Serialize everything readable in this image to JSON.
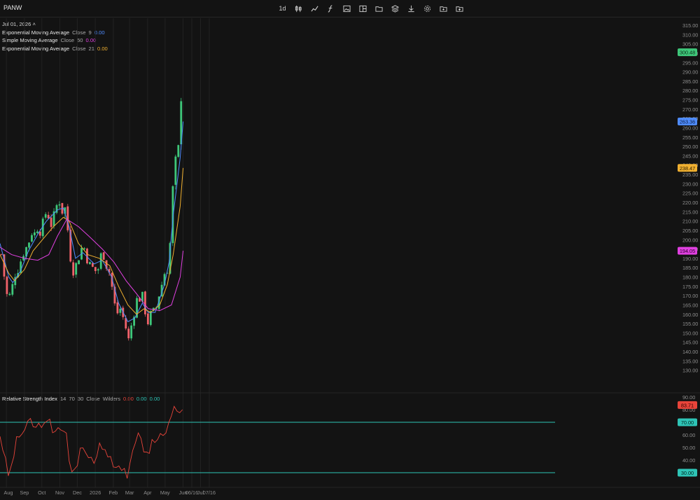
{
  "ticker": "PANW",
  "toolbar": {
    "interval_label": "1d",
    "icons": [
      "candles-icon",
      "line-chart-icon",
      "indicators-icon",
      "image-icon",
      "panel-icon",
      "folder-icon",
      "layers-icon",
      "download-icon",
      "settings-icon",
      "folder-add-icon",
      "file-upload-icon"
    ]
  },
  "legend": {
    "date": "Jul 01, 2026",
    "items": [
      {
        "name": "Exponential Moving Average",
        "source": "Close",
        "length": "9",
        "value": "0.00",
        "color": "#4f8cff"
      },
      {
        "name": "Simple Moving Average",
        "source": "Close",
        "length": "50",
        "value": "0.00",
        "color": "#e040e0"
      },
      {
        "name": "Exponential Moving Average",
        "source": "Close",
        "length": "21",
        "value": "0.00",
        "color": "#f0b030"
      }
    ]
  },
  "rsi_legend": {
    "name": "Relative Strength Index",
    "params": [
      "14",
      "70",
      "30",
      "Close",
      "Wilders"
    ],
    "values": [
      "0.00",
      "0.00",
      "0.00"
    ]
  },
  "colors": {
    "up": "#3ec77a",
    "down": "#f0626a",
    "ema9": "#4f8cff",
    "sma50": "#e040e0",
    "ema21": "#f0b030",
    "rsi": "#e8443a",
    "rsi_band": "#2ec4b6",
    "bg": "#131313",
    "grid": "#222222"
  },
  "price_labels": {
    "last": "300.48",
    "ema9": "263.36",
    "ema21": "238.47",
    "sma50": "194.05",
    "rsi": "83.71",
    "rsi_upper": "70.00",
    "rsi_lower": "30.00"
  },
  "x_axis_labels": [
    "Aug",
    "Sep",
    "Oct",
    "Nov",
    "Dec",
    "2026",
    "Feb",
    "Mar",
    "Apr",
    "May",
    "Jun",
    "06/16",
    "Jul",
    "07/16"
  ],
  "chart_data": [
    {
      "type": "candlestick",
      "title": "PANW",
      "ylim": [
        125,
        315
      ],
      "y_ticks": [
        130,
        135,
        140,
        145,
        150,
        155,
        160,
        165,
        170,
        175,
        180,
        185,
        190,
        195,
        200,
        205,
        210,
        215,
        220,
        225,
        230,
        235,
        240,
        245,
        250,
        255,
        260,
        265,
        270,
        275,
        280,
        285,
        290,
        295,
        300,
        305,
        310,
        315
      ],
      "close_path": [
        [
          "2025-07-21",
          201
        ],
        [
          "2025-07-24",
          190
        ],
        [
          "2025-07-28",
          181
        ],
        [
          "2025-07-31",
          172
        ],
        [
          "2025-08-05",
          168
        ],
        [
          "2025-08-08",
          172
        ],
        [
          "2025-08-12",
          176
        ],
        [
          "2025-08-15",
          181
        ],
        [
          "2025-08-20",
          183
        ],
        [
          "2025-08-25",
          188
        ],
        [
          "2025-08-29",
          192
        ],
        [
          "2025-09-03",
          195
        ],
        [
          "2025-09-08",
          198
        ],
        [
          "2025-09-12",
          203
        ],
        [
          "2025-09-16",
          205
        ],
        [
          "2025-09-19",
          203
        ],
        [
          "2025-09-24",
          207
        ],
        [
          "2025-09-29",
          204
        ],
        [
          "2025-10-02",
          208
        ],
        [
          "2025-10-06",
          212
        ],
        [
          "2025-10-09",
          216
        ],
        [
          "2025-10-13",
          212
        ],
        [
          "2025-10-16",
          207
        ],
        [
          "2025-10-21",
          212
        ],
        [
          "2025-10-24",
          215
        ],
        [
          "2025-10-28",
          220
        ],
        [
          "2025-10-31",
          221
        ],
        [
          "2025-11-04",
          216
        ],
        [
          "2025-11-07",
          214
        ],
        [
          "2025-11-11",
          218
        ],
        [
          "2025-11-13",
          210
        ],
        [
          "2025-11-17",
          198
        ],
        [
          "2025-11-20",
          188
        ],
        [
          "2025-11-24",
          183
        ],
        [
          "2025-11-28",
          186
        ],
        [
          "2025-12-03",
          190
        ],
        [
          "2025-12-08",
          195
        ],
        [
          "2025-12-11",
          198
        ],
        [
          "2025-12-16",
          192
        ],
        [
          "2025-12-19",
          188
        ],
        [
          "2025-12-24",
          186
        ],
        [
          "2025-12-30",
          184
        ],
        [
          "2026-01-05",
          182
        ],
        [
          "2026-01-08",
          190
        ],
        [
          "2026-01-13",
          193
        ],
        [
          "2026-01-16",
          191
        ],
        [
          "2026-01-21",
          185
        ],
        [
          "2026-01-26",
          182
        ],
        [
          "2026-01-29",
          176
        ],
        [
          "2026-02-02",
          168
        ],
        [
          "2026-02-05",
          162
        ],
        [
          "2026-02-10",
          160
        ],
        [
          "2026-02-13",
          163
        ],
        [
          "2026-02-18",
          158
        ],
        [
          "2026-02-23",
          152
        ],
        [
          "2026-02-26",
          145
        ],
        [
          "2026-03-02",
          150
        ],
        [
          "2026-03-05",
          156
        ],
        [
          "2026-03-10",
          162
        ],
        [
          "2026-03-13",
          168
        ],
        [
          "2026-03-18",
          168
        ],
        [
          "2026-03-23",
          170
        ],
        [
          "2026-03-26",
          164
        ],
        [
          "2026-03-30",
          158
        ],
        [
          "2026-04-02",
          155
        ],
        [
          "2026-04-06",
          160
        ],
        [
          "2026-04-09",
          163
        ],
        [
          "2026-04-14",
          160
        ],
        [
          "2026-04-17",
          166
        ],
        [
          "2026-04-22",
          172
        ],
        [
          "2026-04-27",
          178
        ],
        [
          "2026-04-30",
          182
        ],
        [
          "2026-05-05",
          184
        ],
        [
          "2026-05-08",
          190
        ],
        [
          "2026-05-12",
          210
        ],
        [
          "2026-05-15",
          232
        ],
        [
          "2026-05-19",
          242
        ],
        [
          "2026-05-22",
          245
        ],
        [
          "2026-05-27",
          255
        ],
        [
          "2026-05-29",
          282
        ],
        [
          "2026-06-01",
          300.48
        ]
      ],
      "series": [
        {
          "name": "Exponential Moving Average (Close, 9)",
          "values": [
            [
              "2025-07-21",
              198
            ],
            [
              "2025-08-05",
              180
            ],
            [
              "2025-08-12",
              177
            ],
            [
              "2025-08-25",
              183
            ],
            [
              "2025-09-08",
              194
            ],
            [
              "2025-09-24",
              203
            ],
            [
              "2025-10-09",
              210
            ],
            [
              "2025-10-28",
              216
            ],
            [
              "2025-11-07",
              217
            ],
            [
              "2025-11-17",
              207
            ],
            [
              "2025-11-28",
              190
            ],
            [
              "2025-12-11",
              193
            ],
            [
              "2025-12-30",
              187
            ],
            [
              "2026-01-13",
              189
            ],
            [
              "2026-01-29",
              180
            ],
            [
              "2026-02-10",
              166
            ],
            [
              "2026-02-26",
              156
            ],
            [
              "2026-03-10",
              158
            ],
            [
              "2026-03-23",
              166
            ],
            [
              "2026-04-02",
              161
            ],
            [
              "2026-04-14",
              161
            ],
            [
              "2026-04-30",
              176
            ],
            [
              "2026-05-08",
              188
            ],
            [
              "2026-05-15",
              213
            ],
            [
              "2026-05-27",
              244
            ],
            [
              "2026-06-01",
              263.36
            ]
          ]
        },
        {
          "name": "Exponential Moving Average (Close, 21)",
          "values": [
            [
              "2025-07-21",
              192
            ],
            [
              "2025-08-05",
              182
            ],
            [
              "2025-08-15",
              178
            ],
            [
              "2025-09-01",
              184
            ],
            [
              "2025-09-16",
              194
            ],
            [
              "2025-10-02",
              200
            ],
            [
              "2025-10-21",
              207
            ],
            [
              "2025-11-07",
              212
            ],
            [
              "2025-11-17",
              210
            ],
            [
              "2025-12-03",
              198
            ],
            [
              "2025-12-19",
              192
            ],
            [
              "2026-01-08",
              190
            ],
            [
              "2026-01-26",
              186
            ],
            [
              "2026-02-10",
              175
            ],
            [
              "2026-02-26",
              165
            ],
            [
              "2026-03-13",
              160
            ],
            [
              "2026-03-26",
              163
            ],
            [
              "2026-04-06",
              161
            ],
            [
              "2026-04-22",
              165
            ],
            [
              "2026-05-05",
              176
            ],
            [
              "2026-05-15",
              192
            ],
            [
              "2026-05-27",
              218
            ],
            [
              "2026-06-01",
              238.47
            ]
          ]
        },
        {
          "name": "Simple Moving Average (Close, 50)",
          "values": [
            [
              "2025-07-21",
              196
            ],
            [
              "2025-08-10",
              192
            ],
            [
              "2025-09-01",
              190
            ],
            [
              "2025-09-24",
              189
            ],
            [
              "2025-10-13",
              192
            ],
            [
              "2025-10-28",
              202
            ],
            [
              "2025-11-13",
              211
            ],
            [
              "2025-12-03",
              207
            ],
            [
              "2025-12-24",
              201
            ],
            [
              "2026-01-13",
              195
            ],
            [
              "2026-02-02",
              188
            ],
            [
              "2026-02-23",
              178
            ],
            [
              "2026-03-13",
              171
            ],
            [
              "2026-04-02",
              163
            ],
            [
              "2026-04-22",
              162
            ],
            [
              "2026-05-12",
              165
            ],
            [
              "2026-05-27",
              180
            ],
            [
              "2026-06-01",
              194.05
            ]
          ]
        }
      ]
    },
    {
      "type": "line",
      "title": "Relative Strength Index",
      "ylim": [
        20,
        90
      ],
      "y_ticks": [
        30,
        40,
        50,
        60,
        70,
        80,
        90
      ],
      "bands": [
        70,
        30
      ],
      "series": [
        {
          "name": "Relative Strength Index",
          "values": [
            [
              "2025-07-21",
              60
            ],
            [
              "2025-07-28",
              45
            ],
            [
              "2025-08-04",
              28
            ],
            [
              "2025-08-10",
              35
            ],
            [
              "2025-08-18",
              55
            ],
            [
              "2025-08-25",
              60
            ],
            [
              "2025-09-03",
              65
            ],
            [
              "2025-09-12",
              72
            ],
            [
              "2025-09-19",
              64
            ],
            [
              "2025-09-29",
              70
            ],
            [
              "2025-10-06",
              66
            ],
            [
              "2025-10-13",
              72
            ],
            [
              "2025-10-21",
              62
            ],
            [
              "2025-10-28",
              68
            ],
            [
              "2025-11-04",
              60
            ],
            [
              "2025-11-11",
              64
            ],
            [
              "2025-11-17",
              40
            ],
            [
              "2025-11-24",
              28
            ],
            [
              "2025-12-01",
              38
            ],
            [
              "2025-12-08",
              52
            ],
            [
              "2025-12-16",
              45
            ],
            [
              "2025-12-24",
              42
            ],
            [
              "2026-01-02",
              40
            ],
            [
              "2026-01-08",
              55
            ],
            [
              "2026-01-16",
              50
            ],
            [
              "2026-01-26",
              42
            ],
            [
              "2026-02-02",
              30
            ],
            [
              "2026-02-10",
              38
            ],
            [
              "2026-02-18",
              32
            ],
            [
              "2026-02-26",
              27
            ],
            [
              "2026-03-05",
              45
            ],
            [
              "2026-03-13",
              58
            ],
            [
              "2026-03-20",
              62
            ],
            [
              "2026-03-26",
              48
            ],
            [
              "2026-04-02",
              40
            ],
            [
              "2026-04-09",
              55
            ],
            [
              "2026-04-17",
              52
            ],
            [
              "2026-04-27",
              62
            ],
            [
              "2026-05-05",
              64
            ],
            [
              "2026-05-12",
              72
            ],
            [
              "2026-05-19",
              83
            ],
            [
              "2026-05-26",
              78
            ],
            [
              "2026-05-29",
              72
            ],
            [
              "2026-06-01",
              83.71
            ]
          ]
        }
      ]
    }
  ]
}
